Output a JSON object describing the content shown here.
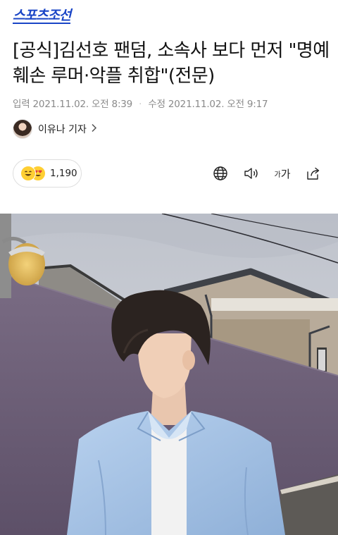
{
  "header": {
    "logo": "스포츠조선"
  },
  "article": {
    "title": "[공식]김선호 팬덤, 소속사 보다 먼저 \"명예훼손 루머·악플 취합\"(전문)",
    "input_label": "입력",
    "input_date": "2021.11.02. 오전 8:39",
    "edit_label": "수정",
    "edit_date": "2021.11.02. 오전 9:17",
    "reporter": "이유나 기자"
  },
  "reactions": {
    "count": "1,190",
    "icons": [
      "grin-emoji-icon",
      "heart-eyes-emoji-icon"
    ]
  },
  "toolbar": {
    "icons": [
      "globe-icon",
      "speaker-icon",
      "font-size-icon",
      "share-icon"
    ],
    "font_size_label_small": "가",
    "font_size_label_large": "가"
  },
  "photo": {
    "description_icon": "article-photo"
  },
  "colors": {
    "brand": "#1a45c6",
    "meta_text": "#8a8a8a",
    "shirt": "#a9c6e8",
    "wall": "#6e5f78"
  }
}
